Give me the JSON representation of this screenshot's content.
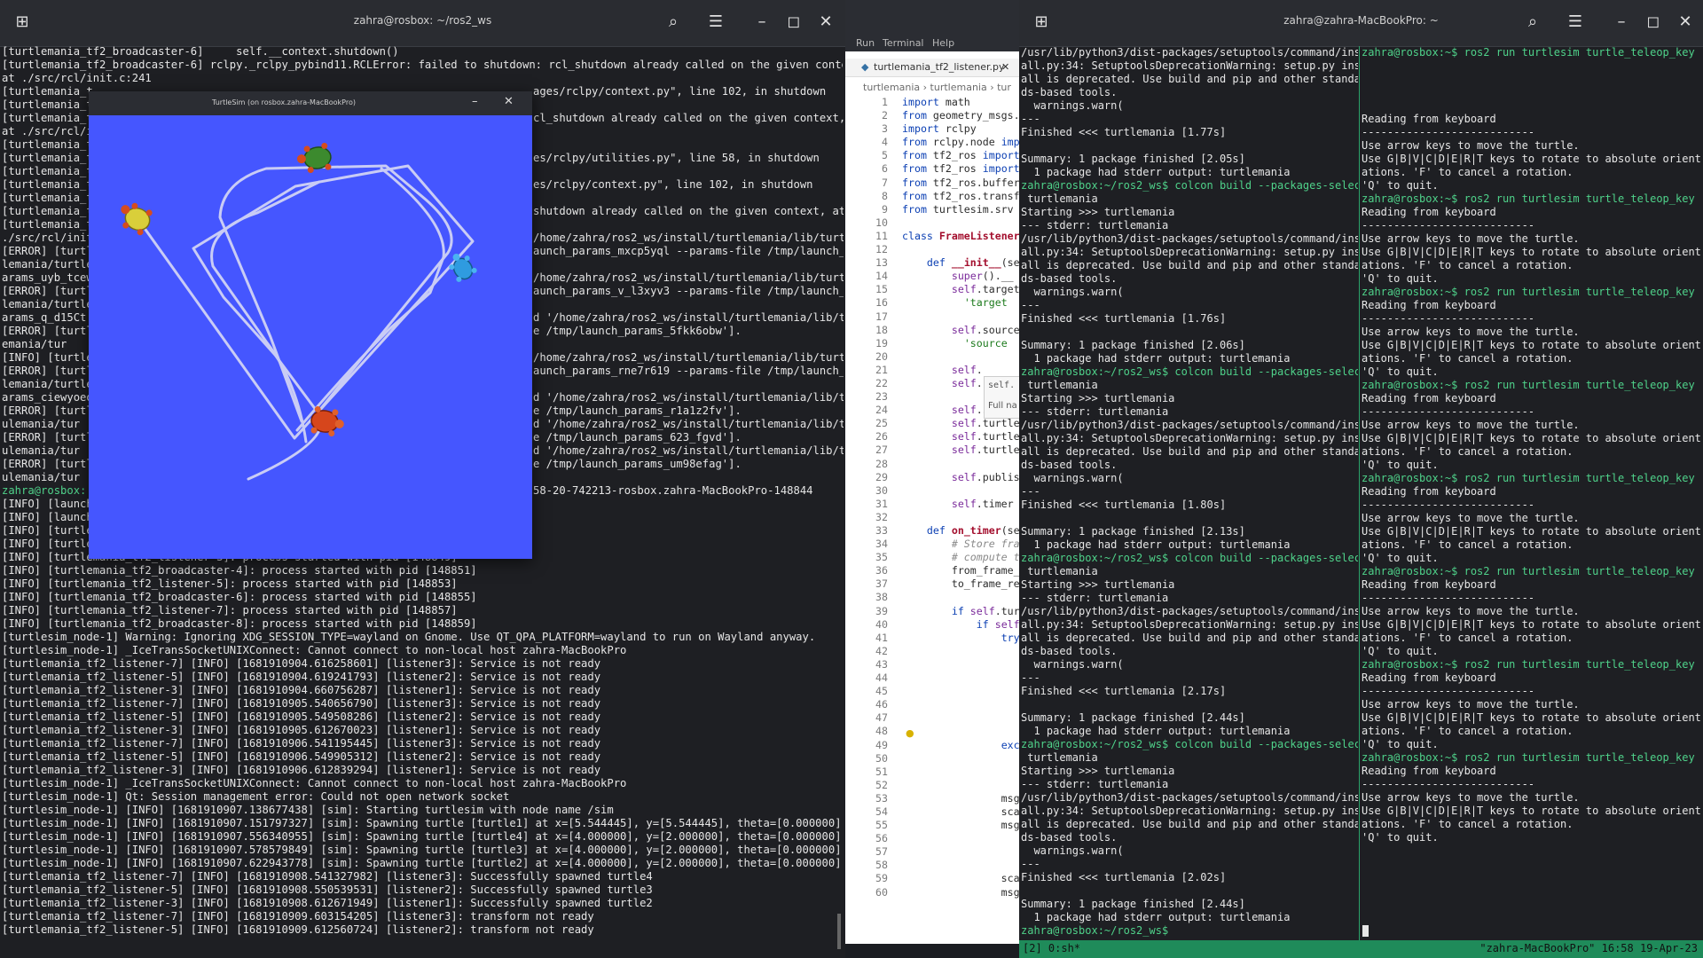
{
  "left_terminal": {
    "title": "zahra@rosbox: ~/ros2_ws",
    "lines": [
      "[turtlemania_tf2_broadcaster-6]     self.__context.shutdown()",
      "[turtlemania_tf2_broadcaster-6] rclpy._rclpy_pybind11.RCLError: failed to shutdown: rcl_shutdown already called on the given context,",
      "at ./src/rcl/init.c:241",
      "[turtlemania_t",
      "[turtlemania_t",
      "[turtlemania_t",
      "at ./src/rcl/i",
      "[turtlemania_t",
      "[turtlemania_t",
      "[turtlemania_t",
      "[turtlemania_t",
      "[turtlemania_t",
      "[turtlemania_t",
      "[turtlemania_t",
      "./src/rcl/init",
      "[ERROR] [turtl",
      "lemania/turtle",
      "arams_uyb_tcew",
      "[ERROR] [turtl",
      "lemania/turtle",
      "arams_q_d15Ct",
      "[ERROR] [turtl",
      "emania/tur",
      "[INFO] [turtle",
      "[ERROR] [turtl",
      "lemania/turtle",
      "arams_ciewyoeo",
      "[ERROR] [turtl",
      "ulemania/tur",
      "[ERROR] [turtl",
      "ulemania/tur",
      "[ERROR] [turtl",
      "ulemania/tur",
      "zahra@rosbox:",
      "[INFO] [launch",
      "[INFO] [launch",
      "[INFO] [turtle",
      "[INFO] [turtle",
      "[INFO] [turtlemania_tf2_listener-3]: process started with pid [148849]",
      "[INFO] [turtlemania_tf2_broadcaster-4]: process started with pid [148851]",
      "[INFO] [turtlemania_tf2_listener-5]: process started with pid [148853]",
      "[INFO] [turtlemania_tf2_broadcaster-6]: process started with pid [148855]",
      "[INFO] [turtlemania_tf2_listener-7]: process started with pid [148857]",
      "[INFO] [turtlemania_tf2_broadcaster-8]: process started with pid [148859]",
      "[turtlesim_node-1] Warning: Ignoring XDG_SESSION_TYPE=wayland on Gnome. Use QT_QPA_PLATFORM=wayland to run on Wayland anyway.",
      "[turtlesim_node-1] _IceTransSocketUNIXConnect: Cannot connect to non-local host zahra-MacBookPro",
      "[turtlemania_tf2_listener-7] [INFO] [1681910904.616258601] [listener3]: Service is not ready",
      "[turtlemania_tf2_listener-5] [INFO] [1681910904.619241793] [listener2]: Service is not ready",
      "[turtlemania_tf2_listener-3] [INFO] [1681910904.660756287] [listener1]: Service is not ready",
      "[turtlemania_tf2_listener-7] [INFO] [1681910905.540656790] [listener3]: Service is not ready",
      "[turtlemania_tf2_listener-5] [INFO] [1681910905.549508286] [listener2]: Service is not ready",
      "[turtlemania_tf2_listener-3] [INFO] [1681910905.612670023] [listener1]: Service is not ready",
      "[turtlemania_tf2_listener-7] [INFO] [1681910906.541195445] [listener3]: Service is not ready",
      "[turtlemania_tf2_listener-5] [INFO] [1681910906.549905312] [listener2]: Service is not ready",
      "[turtlemania_tf2_listener-3] [INFO] [1681910906.612839294] [listener1]: Service is not ready",
      "[turtlesim_node-1] _IceTransSocketUNIXConnect: Cannot connect to non-local host zahra-MacBookPro",
      "[turtlesim_node-1] Qt: Session management error: Could not open network socket",
      "[turtlesim_node-1] [INFO] [1681910907.138677438] [sim]: Starting turtlesim with node name /sim",
      "[turtlesim_node-1] [INFO] [1681910907.151797327] [sim]: Spawning turtle [turtle1] at x=[5.544445], y=[5.544445], theta=[0.000000]",
      "[turtlesim_node-1] [INFO] [1681910907.556340955] [sim]: Spawning turtle [turtle4] at x=[4.000000], y=[2.000000], theta=[0.000000]",
      "[turtlesim_node-1] [INFO] [1681910907.578579849] [sim]: Spawning turtle [turtle3] at x=[4.000000], y=[2.000000], theta=[0.000000]",
      "[turtlesim_node-1] [INFO] [1681910907.622943778] [sim]: Spawning turtle [turtle2] at x=[4.000000], y=[2.000000], theta=[0.000000]",
      "[turtlemania_tf2_listener-7] [INFO] [1681910908.541327982] [listener3]: Successfully spawned turtle4",
      "[turtlemania_tf2_listener-5] [INFO] [1681910908.550539531] [listener2]: Successfully spawned turtle3",
      "[turtlemania_tf2_listener-3] [INFO] [1681910908.612671949] [listener1]: Successfully spawned turtle2",
      "[turtlemania_tf2_listener-7] [INFO] [1681910909.603154205] [listener3]: transform not ready",
      "[turtlemania_tf2_listener-5] [INFO] [1681910909.612560724] [listener2]: transform not ready"
    ],
    "right_overflow": [
      {
        "row": 3,
        "text": "ages/rclpy/context.py\", line 102, in shutdown"
      },
      {
        "row": 5,
        "text": "cl_shutdown already called on the given context,"
      },
      {
        "row": 8,
        "text": "es/rclpy/utilities.py\", line 58, in shutdown"
      },
      {
        "row": 10,
        "text": "es/rclpy/context.py\", line 102, in shutdown"
      },
      {
        "row": 12,
        "text": "shutdown already called on the given context, at"
      },
      {
        "row": 14,
        "text": "/home/zahra/ros2_ws/install/turtlemania/lib/turt"
      },
      {
        "row": 15,
        "text": "aunch_params_mxcp5yql --params-file /tmp/launch_p"
      },
      {
        "row": 17,
        "text": "/home/zahra/ros2_ws/install/turtlemania/lib/turt"
      },
      {
        "row": 18,
        "text": "aunch_params_v_l3xyv3 --params-file /tmp/launch_p"
      },
      {
        "row": 20,
        "text": "d '/home/zahra/ros2_ws/install/turtlemania/lib/t"
      },
      {
        "row": 21,
        "text": "e /tmp/launch_params_5fkk6obw']."
      },
      {
        "row": 23,
        "text": "/home/zahra/ros2_ws/install/turtlemania/lib/turt"
      },
      {
        "row": 24,
        "text": "aunch_params_rne7r619 --params-file /tmp/launch_p"
      },
      {
        "row": 26,
        "text": "d '/home/zahra/ros2_ws/install/turtlemania/lib/t"
      },
      {
        "row": 27,
        "text": "e /tmp/launch_params_r1a1z2fv']."
      },
      {
        "row": 28,
        "text": "d '/home/zahra/ros2_ws/install/turtlemania/lib/t"
      },
      {
        "row": 29,
        "text": "e /tmp/launch_params_623_fgvd']."
      },
      {
        "row": 30,
        "text": "d '/home/zahra/ros2_ws/install/turtlemania/lib/t"
      },
      {
        "row": 31,
        "text": "e /tmp/launch_params_um98efag']."
      },
      {
        "row": 33,
        "text": "58-20-742213-rosbox.zahra-MacBookPro-148844"
      }
    ]
  },
  "turtlesim": {
    "title": "TurtleSim (on rosbox.zahra-MacBookPro)",
    "minimize": "–",
    "close": "✕"
  },
  "editor": {
    "menu": [
      "Run",
      "Terminal",
      "Help"
    ],
    "tab_label": "turtlemania_tf2_listener.py",
    "tab_close": "✕",
    "breadcrumb": "turtlemania › turtlemania › tur",
    "tooltip1": "self.",
    "tooltip2": "Full na",
    "line_numbers": [
      "1",
      "2",
      "3",
      "4",
      "5",
      "6",
      "7",
      "8",
      "9",
      "10",
      "11",
      "12",
      "13",
      "14",
      "15",
      "16",
      "17",
      "18",
      "19",
      "20",
      "21",
      "22",
      "23",
      "24",
      "25",
      "26",
      "27",
      "28",
      "29",
      "30",
      "31",
      "32",
      "33",
      "34",
      "35",
      "36",
      "37",
      "38",
      "39",
      "40",
      "41",
      "42",
      "43",
      "44",
      "45",
      "46",
      "47",
      "48",
      "49",
      "50",
      "51",
      "52",
      "53",
      "54",
      "55",
      "56",
      "57",
      "58",
      "59",
      "60"
    ]
  },
  "right_terminal": {
    "title": "zahra@zahra-MacBookPro: ~",
    "left_pane": [
      "/usr/lib/python3/dist-packages/setuptools/command/inst",
      "all.py:34: SetuptoolsDeprecationWarning: setup.py inst",
      "all is deprecated. Use build and pip and other standar",
      "ds-based tools.",
      "  warnings.warn(",
      "---",
      "Finished <<< turtlemania [1.77s]",
      "",
      "Summary: 1 package finished [2.05s]",
      "  1 package had stderr output: turtlemania",
      "zahra@rosbox:~/ros2_ws$ colcon build --packages-select",
      " turtlemania",
      "Starting >>> turtlemania",
      "--- stderr: turtlemania",
      "/usr/lib/python3/dist-packages/setuptools/command/inst",
      "all.py:34: SetuptoolsDeprecationWarning: setup.py inst",
      "all is deprecated. Use build and pip and other standar",
      "ds-based tools.",
      "  warnings.warn(",
      "---",
      "Finished <<< turtlemania [1.76s]",
      "",
      "Summary: 1 package finished [2.06s]",
      "  1 package had stderr output: turtlemania",
      "zahra@rosbox:~/ros2_ws$ colcon build --packages-select",
      " turtlemania",
      "Starting >>> turtlemania",
      "--- stderr: turtlemania",
      "/usr/lib/python3/dist-packages/setuptools/command/inst",
      "all.py:34: SetuptoolsDeprecationWarning: setup.py inst",
      "all is deprecated. Use build and pip and other standar",
      "ds-based tools.",
      "  warnings.warn(",
      "---",
      "Finished <<< turtlemania [1.80s]",
      "",
      "Summary: 1 package finished [2.13s]",
      "  1 package had stderr output: turtlemania",
      "zahra@rosbox:~/ros2_ws$ colcon build --packages-select",
      " turtlemania",
      "Starting >>> turtlemania",
      "--- stderr: turtlemania",
      "/usr/lib/python3/dist-packages/setuptools/command/inst",
      "all.py:34: SetuptoolsDeprecationWarning: setup.py inst",
      "all is deprecated. Use build and pip and other standar",
      "ds-based tools.",
      "  warnings.warn(",
      "---",
      "Finished <<< turtlemania [2.17s]",
      "",
      "Summary: 1 package finished [2.44s]",
      "  1 package had stderr output: turtlemania",
      "zahra@rosbox:~/ros2_ws$ colcon build --packages-select",
      " turtlemania",
      "Starting >>> turtlemania",
      "--- stderr: turtlemania",
      "/usr/lib/python3/dist-packages/setuptools/command/inst",
      "all.py:34: SetuptoolsDeprecationWarning: setup.py inst",
      "all is deprecated. Use build and pip and other standar",
      "ds-based tools.",
      "  warnings.warn(",
      "---",
      "Finished <<< turtlemania [2.02s]",
      "",
      "Summary: 1 package finished [2.44s]",
      "  1 package had stderr output: turtlemania",
      "zahra@rosbox:~/ros2_ws$"
    ],
    "right_pane": [
      "zahra@rosbox:~$ ros2 run turtlesim turtle_teleop_key",
      "",
      "",
      "",
      "",
      "Reading from keyboard",
      "---------------------------",
      "Use arrow keys to move the turtle.",
      "Use G|B|V|C|D|E|R|T keys to rotate to absolute orient",
      "ations. 'F' to cancel a rotation.",
      "'Q' to quit.",
      "zahra@rosbox:~$ ros2 run turtlesim turtle_teleop_key",
      "Reading from keyboard",
      "---------------------------",
      "Use arrow keys to move the turtle.",
      "Use G|B|V|C|D|E|R|T keys to rotate to absolute orient",
      "ations. 'F' to cancel a rotation.",
      "'Q' to quit.",
      "zahra@rosbox:~$ ros2 run turtlesim turtle_teleop_key",
      "Reading from keyboard",
      "---------------------------",
      "Use arrow keys to move the turtle.",
      "Use G|B|V|C|D|E|R|T keys to rotate to absolute orient",
      "ations. 'F' to cancel a rotation.",
      "'Q' to quit.",
      "zahra@rosbox:~$ ros2 run turtlesim turtle_teleop_key",
      "Reading from keyboard",
      "---------------------------",
      "Use arrow keys to move the turtle.",
      "Use G|B|V|C|D|E|R|T keys to rotate to absolute orient",
      "ations. 'F' to cancel a rotation.",
      "'Q' to quit.",
      "zahra@rosbox:~$ ros2 run turtlesim turtle_teleop_key",
      "Reading from keyboard",
      "---------------------------",
      "Use arrow keys to move the turtle.",
      "Use G|B|V|C|D|E|R|T keys to rotate to absolute orient",
      "ations. 'F' to cancel a rotation.",
      "'Q' to quit.",
      "zahra@rosbox:~$ ros2 run turtlesim turtle_teleop_key",
      "Reading from keyboard",
      "---------------------------",
      "Use arrow keys to move the turtle.",
      "Use G|B|V|C|D|E|R|T keys to rotate to absolute orient",
      "ations. 'F' to cancel a rotation.",
      "'Q' to quit.",
      "zahra@rosbox:~$ ros2 run turtlesim turtle_teleop_key",
      "Reading from keyboard",
      "---------------------------",
      "Use arrow keys to move the turtle.",
      "Use G|B|V|C|D|E|R|T keys to rotate to absolute orient",
      "ations. 'F' to cancel a rotation.",
      "'Q' to quit.",
      "zahra@rosbox:~$ ros2 run turtlesim turtle_teleop_key",
      "Reading from keyboard",
      "---------------------------",
      "Use arrow keys to move the turtle.",
      "Use G|B|V|C|D|E|R|T keys to rotate to absolute orient",
      "ations. 'F' to cancel a rotation.",
      "'Q' to quit."
    ],
    "status_left": "[2] 0:sh*",
    "status_right": "\"zahra-MacBookPro\" 16:58 19-Apr-23"
  },
  "colors": {
    "canvas": "#4556ff",
    "terminal_bg": "#1e1f23",
    "status_green": "#1f8b5a"
  }
}
